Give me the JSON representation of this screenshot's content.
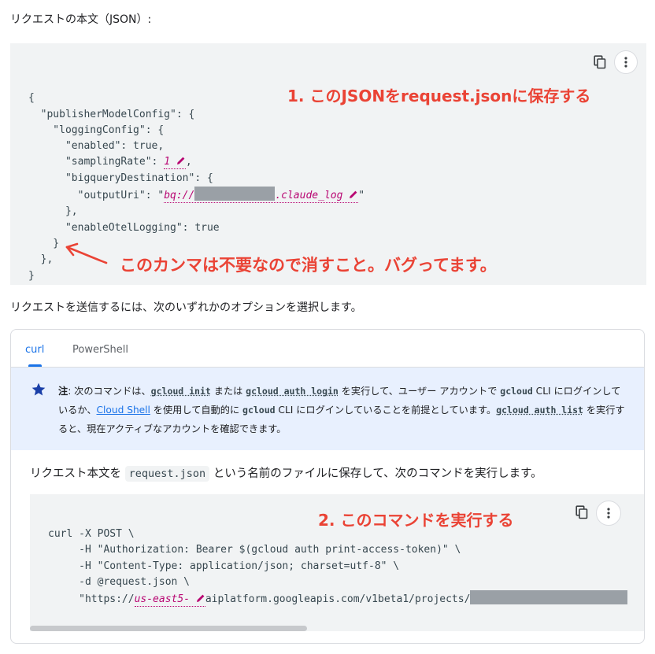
{
  "heading": "リクエストの本文（JSON）:",
  "json_block": {
    "lines": [
      {
        "text": "{"
      },
      {
        "text": "  \"publisherModelConfig\": {"
      },
      {
        "text": "    \"loggingConfig\": {"
      },
      {
        "text": "      \"enabled\": true,"
      },
      {
        "prefix": "      \"samplingRate\": ",
        "var": "1",
        "suffix": ","
      },
      {
        "text": "      \"bigqueryDestination\": {"
      },
      {
        "prefix": "        \"outputUri\": \"",
        "var_pre": "bq://",
        "var": ".claude_log",
        "suffix": "\""
      },
      {
        "text": "      },"
      },
      {
        "text": "      \"enableOtelLogging\": true"
      },
      {
        "text": "    }"
      },
      {
        "text": "  },"
      },
      {
        "text": "}"
      }
    ],
    "copy_icon": "copy-icon",
    "menu_icon": "more-vert-icon"
  },
  "annotations": {
    "save_json": "1. このJSONをrequest.jsonに保存する",
    "comma_note": "このカンマは不要なので消すこと。バグってます。",
    "run_command": "2. このコマンドを実行する"
  },
  "mid_paragraph": "リクエストを送信するには、次のいずれかのオプションを選択します。",
  "tabs": [
    "curl",
    "PowerShell"
  ],
  "active_tab": "curl",
  "note": {
    "icon": "star-icon",
    "label": "注",
    "t1": ": 次のコマンドは、",
    "c1": "gcloud init",
    "t2": " または ",
    "c2": "gcloud auth login",
    "t3": " を実行して、ユーザー アカウントで ",
    "c3": "gcloud",
    "t4": " CLI にログインしているか、",
    "link": "Cloud Shell",
    "t5": " を使用して自動的に ",
    "c4": "gcloud",
    "t6": " CLI にログインしていることを前提としています。",
    "c5": "gcloud auth list",
    "t7": " を実行すると、現在アクティブなアカウントを確認できます。"
  },
  "instruction": {
    "before": "リクエスト本文を ",
    "file": "request.json",
    "after": " という名前のファイルに保存して、次のコマンドを実行します。"
  },
  "curl_block": {
    "lines": [
      "curl -X POST \\",
      "     -H \"Authorization: Bearer $(gcloud auth print-access-token)\" \\",
      "     -H \"Content-Type: application/json; charset=utf-8\" \\",
      "     -d @request.json \\"
    ],
    "last_prefix": "     \"https://",
    "last_var": "us-east5-",
    "last_suffix": "aiplatform.googleapis.com/v1beta1/projects/",
    "copy_icon": "copy-icon",
    "menu_icon": "more-vert-icon"
  }
}
